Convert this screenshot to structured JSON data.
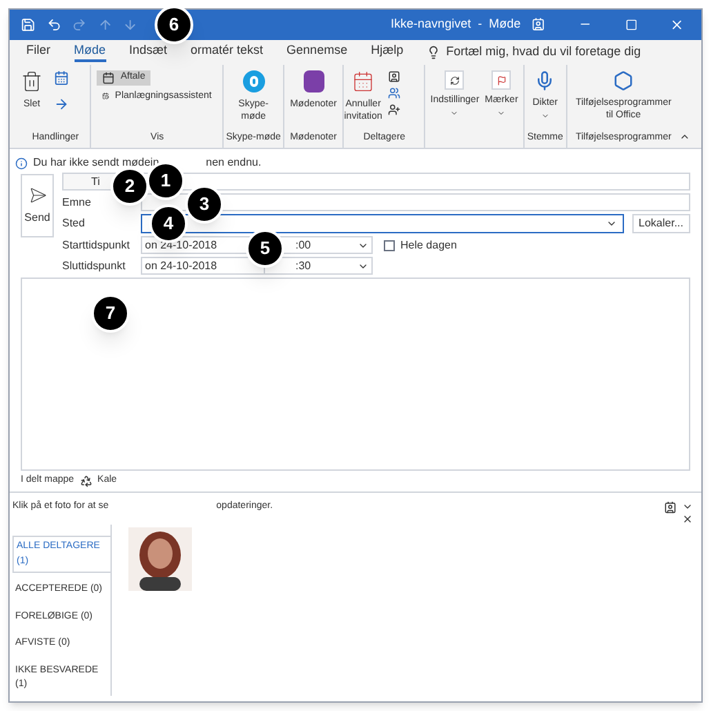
{
  "title_bar": {
    "title": "Ikke-navngivet  -  Møde"
  },
  "menu_tabs": [
    {
      "label": "Filer",
      "selected": false
    },
    {
      "label": "Møde",
      "selected": true
    },
    {
      "label": "Indsæt",
      "selected": false
    },
    {
      "label": "ormatér tekst",
      "selected": false
    },
    {
      "label": "Gennemse",
      "selected": false
    },
    {
      "label": "Hjælp",
      "selected": false
    }
  ],
  "tell_me": {
    "text": "Fortæl mig, hvad du vil foretage dig"
  },
  "ribbon": {
    "slet": "Slet",
    "aftale": {
      "label": "Aftale",
      "selected": true
    },
    "planlaegning": "Planlægningsassistent",
    "skype": [
      "Skype-",
      "møde"
    ],
    "modenoter": "Mødenoter",
    "annuller": [
      "Annuller",
      "invitation"
    ],
    "indstillinger": "Indstillinger",
    "maerker": "Mærker",
    "dikter": "Dikter",
    "tilfoj": [
      "Tilføjelsesprogrammer",
      "til Office"
    ],
    "groups": [
      "Handlinger",
      "Vis",
      "Skype-møde",
      "Mødenoter",
      "Deltagere",
      "Stemme",
      "Tilføjelsesprogrammer"
    ]
  },
  "info": [
    "Du har ikke sendt mødein",
    "nen endnu."
  ],
  "form": {
    "send": "Send",
    "to": "Ti",
    "subject": "Emne",
    "location": "Sted",
    "rooms": "Lokaler...",
    "start_label": "Starttidspunkt",
    "start_date": "on 24-10-2018",
    "start_time": ":00",
    "end_label": "Sluttidspunkt",
    "end_date": "on 24-10-2018",
    "end_time": ":30",
    "all_day": {
      "label": "Hele dagen",
      "checked": false
    }
  },
  "footer": [
    "I delt mappe",
    "Kale"
  ],
  "people": {
    "hint": [
      "Klik på et foto for at se",
      "opdateringer."
    ],
    "filters": [
      {
        "label": "ALLE DELTAGERE (1)",
        "selected": true
      },
      {
        "label": "ACCEPTEREDE (0)",
        "selected": false
      },
      {
        "label": "FORELØBIGE (0)",
        "selected": false
      },
      {
        "label": "AFVISTE (0)",
        "selected": false
      },
      {
        "label": "IKKE BESVAREDE (1)",
        "selected": false
      }
    ]
  },
  "callouts": [
    "1",
    "2",
    "3",
    "4",
    "5",
    "6",
    "7"
  ]
}
